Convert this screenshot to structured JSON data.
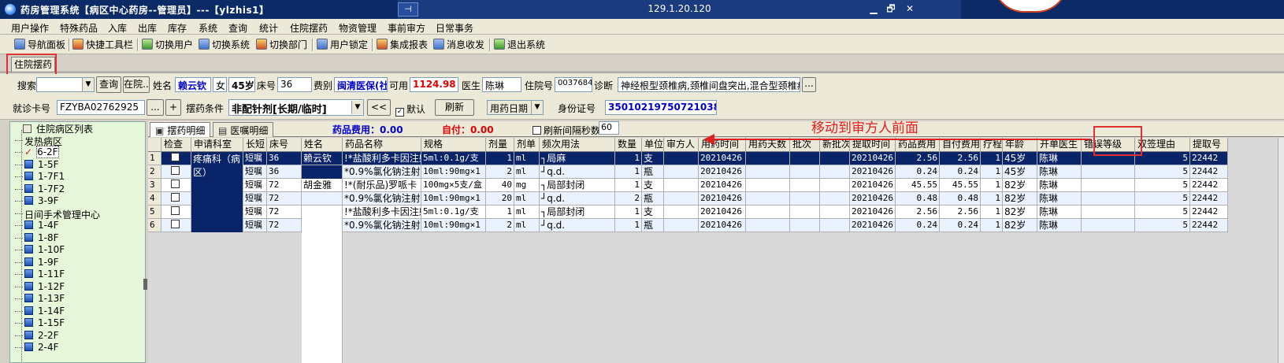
{
  "window": {
    "title": "药房管理系统【病区中心药房--管理员】---【ylzhis1】",
    "remote_ip": "129.1.20.120",
    "pin_glyph": "⊣",
    "min_glyph": "▁",
    "restore_glyph": "🗗",
    "close_glyph": "✕"
  },
  "menu": [
    "用户操作",
    "特殊药品",
    "入库",
    "出库",
    "库存",
    "系统",
    "查询",
    "统计",
    "住院摆药",
    "物资管理",
    "事前审方",
    "日常事务"
  ],
  "toolbar": [
    "导航面板",
    "快捷工具栏",
    "切换用户",
    "切换系统",
    "切换部门",
    "用户锁定",
    "集成报表",
    "消息收发",
    "退出系统"
  ],
  "main_tab": "住院摆药",
  "form": {
    "search_label": "搜索",
    "query_button": "查询",
    "inhospital_button": "在院..",
    "name_label": "姓名",
    "name_value": "赖云钦",
    "gender_value": "女",
    "age_value": "45岁",
    "bed_label": "床号",
    "bed_value": "36",
    "feetype_label": "费别",
    "feetype_value": "闽清医保(社",
    "available_label": "可用",
    "available_value": "1124.98",
    "doctor_label": "医生",
    "doctor_value": "陈琳",
    "inpatient_label": "住院号",
    "inpatient_value": "00376841",
    "diagnosis_label": "诊断",
    "diagnosis_value": "神经根型颈椎病,颈椎间盘突出,混合型颈椎病",
    "ellipsis": "...",
    "card_label": "就诊卡号",
    "card_value": "FZYBA02762925",
    "plus": "+",
    "condition_label": "摆药条件",
    "condition_value": "非配针剂[长期/临时]",
    "back_button": "<<",
    "default_label": "默认",
    "refresh_button": "刷新",
    "date_type_value": "用药日期",
    "idcard_label": "身份证号",
    "idcard_value": "350102197507210382"
  },
  "tree": {
    "root": "住院病区列表",
    "items": [
      "发热病区",
      "6-2F",
      "1-5F",
      "1-7F1",
      "1-7F2",
      "3-9F",
      "日间手术管理中心",
      "1-4F",
      "1-8F",
      "1-10F",
      "1-9F",
      "1-11F",
      "1-12F",
      "1-13F",
      "1-14F",
      "1-15F",
      "2-2F",
      "2-4F"
    ],
    "selected": "6-2F"
  },
  "detail": {
    "tab1": "摆药明细",
    "tab2": "医嘱明细",
    "drug_fee_label": "药品费用：",
    "drug_fee_value": "0.00",
    "self_pay_label": "自付：",
    "self_pay_value": "0.00",
    "auto_refresh_label": "刷新间隔秒数",
    "auto_refresh_value": "60"
  },
  "annotation": "移动到审方人前面",
  "colors": {
    "accent_red": "#e02020",
    "selected_row": "#0a246a",
    "title_bar": "#0b2a66",
    "tree_bg": "#e6f7d9"
  },
  "grid": {
    "headers": [
      "",
      "检查",
      "申请科室",
      "长短",
      "床号",
      "姓名",
      "药品名称",
      "规格",
      "剂量",
      "剂单",
      "频次用法",
      "数量",
      "单位",
      "审方人",
      "用药时间",
      "用药天数",
      "批次",
      "新批次",
      "提取时间",
      "药品费用",
      "自付费用",
      "疗程",
      "年龄",
      "开单医生",
      "错误等级",
      "双签理由",
      "提取号"
    ],
    "dept": "疼痛科（病区）",
    "rows": [
      [
        "1",
        "",
        "",
        "短嘱",
        "36",
        "赖云钦",
        "!*盐酸利多卡因注射",
        "5ml:0.1g/支",
        "1",
        "ml",
        "┐局麻",
        "1",
        "支",
        "",
        "20210426",
        "",
        "",
        "",
        "20210426",
        "2.56",
        "2.56",
        "1",
        "45岁",
        "陈琳",
        "",
        "5",
        "22442"
      ],
      [
        "2",
        "",
        "",
        "短嘱",
        "36",
        "",
        "*0.9%氯化钠注射液",
        "10ml:90mg×1",
        "2",
        "ml",
        "┘q.d.",
        "1",
        "瓶",
        "",
        "20210426",
        "",
        "",
        "",
        "20210426",
        "0.24",
        "0.24",
        "1",
        "45岁",
        "陈琳",
        "",
        "5",
        "22442"
      ],
      [
        "3",
        "",
        "",
        "短嘱",
        "72",
        "胡金雅",
        "!*(耐乐品)罗哌卡",
        "100mg×5支/盒",
        "40",
        "mg",
        "┐局部封闭",
        "1",
        "支",
        "",
        "20210426",
        "",
        "",
        "",
        "20210426",
        "45.55",
        "45.55",
        "1",
        "82岁",
        "陈琳",
        "",
        "5",
        "22442"
      ],
      [
        "4",
        "",
        "",
        "短嘱",
        "72",
        "",
        "*0.9%氯化钠注射液",
        "10ml:90mg×1",
        "20",
        "ml",
        "┘q.d.",
        "2",
        "瓶",
        "",
        "20210426",
        "",
        "",
        "",
        "20210426",
        "0.48",
        "0.48",
        "1",
        "82岁",
        "陈琳",
        "",
        "5",
        "22442"
      ],
      [
        "5",
        "",
        "",
        "短嘱",
        "72",
        "",
        "!*盐酸利多卡因注射",
        "5ml:0.1g/支",
        "1",
        "ml",
        "┐局部封闭",
        "1",
        "支",
        "",
        "20210426",
        "",
        "",
        "",
        "20210426",
        "2.56",
        "2.56",
        "1",
        "82岁",
        "陈琳",
        "",
        "5",
        "22442"
      ],
      [
        "6",
        "",
        "",
        "短嘱",
        "72",
        "",
        "*0.9%氯化钠注射液",
        "10ml:90mg×1",
        "2",
        "ml",
        "┘q.d.",
        "1",
        "瓶",
        "",
        "20210426",
        "",
        "",
        "",
        "20210426",
        "0.24",
        "0.24",
        "1",
        "82岁",
        "陈琳",
        "",
        "5",
        "22442"
      ]
    ]
  }
}
